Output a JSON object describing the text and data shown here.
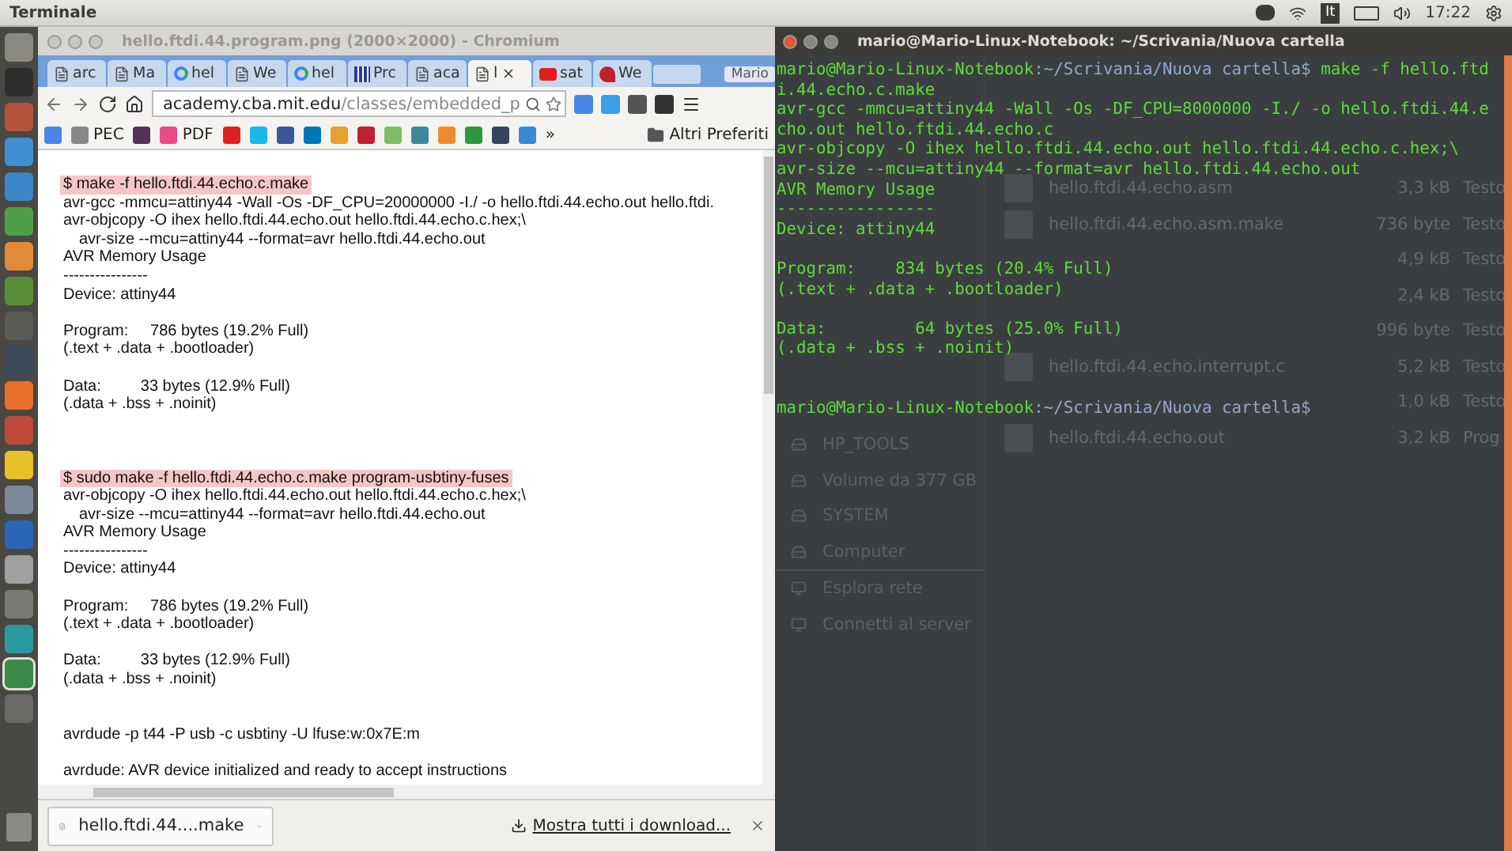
{
  "top_panel": {
    "title": "Terminale",
    "keyboard": "It",
    "clock": "17:22"
  },
  "launcher": [
    {
      "color": "#8a8a80",
      "selected": false
    },
    {
      "color": "#2e2e2e",
      "selected": false
    },
    {
      "color": "#b5533c",
      "selected": false
    },
    {
      "color": "#3f8fd2",
      "selected": false
    },
    {
      "color": "#3a86c8",
      "selected": false
    },
    {
      "color": "#4ea046",
      "selected": false
    },
    {
      "color": "#e08a3a",
      "selected": false
    },
    {
      "color": "#5a8f3a",
      "selected": false
    },
    {
      "color": "#5b5b55",
      "selected": false
    },
    {
      "color": "#3b4a5a",
      "selected": false
    },
    {
      "color": "#e8702a",
      "selected": false
    },
    {
      "color": "#c04a3a",
      "selected": false
    },
    {
      "color": "#e8c02a",
      "selected": false
    },
    {
      "color": "#7a8a9a",
      "selected": false
    },
    {
      "color": "#2a66b8",
      "selected": false
    },
    {
      "color": "#a0a0a0",
      "selected": false
    },
    {
      "color": "#7a7a72",
      "selected": false
    },
    {
      "color": "#2a9aa0",
      "selected": false
    },
    {
      "color": "#3a8a4a",
      "selected": true
    },
    {
      "color": "#6a6a66",
      "selected": false
    }
  ],
  "browser": {
    "title": "hello.ftdi.44.program.png (2000×2000) - Chromium",
    "tabs": [
      {
        "label": "arc",
        "kind": "page",
        "selected": false
      },
      {
        "label": "Ma",
        "kind": "page",
        "selected": false
      },
      {
        "label": "hel",
        "kind": "google",
        "selected": false
      },
      {
        "label": "We",
        "kind": "page",
        "selected": false
      },
      {
        "label": "hel",
        "kind": "google",
        "selected": false
      },
      {
        "label": "Prc",
        "kind": "grid",
        "selected": false
      },
      {
        "label": "aca",
        "kind": "page",
        "selected": false
      },
      {
        "label": "l",
        "kind": "page",
        "selected": true
      },
      {
        "label": "sat",
        "kind": "video",
        "selected": false
      },
      {
        "label": "We",
        "kind": "bird",
        "selected": false
      }
    ],
    "profile": "Mario",
    "url_host": "academy.cba.mit.edu",
    "url_path": "/classes/embedded_p",
    "extensions": [
      {
        "color": "#4a86e8"
      },
      {
        "color": "#3aa0e8"
      },
      {
        "color": "#555555"
      },
      {
        "color": "#333333"
      }
    ],
    "bookmarks": [
      {
        "color": "#4a86e8"
      },
      {
        "label": "PEC",
        "color": "#888888"
      },
      {
        "color": "#55305a"
      },
      {
        "label": "PDF",
        "color": "#e84a8a"
      },
      {
        "color": "#e02020"
      },
      {
        "color": "#1ab7ea"
      },
      {
        "color": "#3b5998"
      },
      {
        "color": "#0077b5"
      },
      {
        "color": "#e8a030"
      },
      {
        "color": "#c02030"
      },
      {
        "color": "#7ac060"
      },
      {
        "color": "#3a8a9a"
      },
      {
        "color": "#f08a30"
      },
      {
        "color": "#2a9a3a"
      },
      {
        "color": "#35465c"
      },
      {
        "color": "#3a8ad8"
      }
    ],
    "more_bookmarks": "»",
    "other_bookmarks": "Altri Preferiti",
    "page_lines": [
      {
        "kind": "command",
        "text": "$ make -f hello.ftdi.44.echo.c.make"
      },
      {
        "kind": "output",
        "text": "avr-gcc -mmcu=attiny44 -Wall -Os -DF_CPU=20000000 -I./ -o hello.ftdi.44.echo.out hello.ftdi."
      },
      {
        "kind": "output",
        "text": "avr-objcopy -O ihex hello.ftdi.44.echo.out hello.ftdi.44.echo.c.hex;\\"
      },
      {
        "kind": "indented",
        "text": "avr-size --mcu=attiny44 --format=avr hello.ftdi.44.echo.out"
      },
      {
        "kind": "output",
        "text": "AVR Memory Usage"
      },
      {
        "kind": "output",
        "text": "----------------"
      },
      {
        "kind": "output",
        "text": "Device: attiny44"
      },
      {
        "kind": "blank"
      },
      {
        "kind": "output",
        "text": "Program:     786 bytes (19.2% Full)"
      },
      {
        "kind": "output",
        "text": "(.text + .data + .bootloader)"
      },
      {
        "kind": "blank"
      },
      {
        "kind": "output",
        "text": "Data:         33 bytes (12.9% Full)"
      },
      {
        "kind": "output",
        "text": "(.data + .bss + .noinit)"
      },
      {
        "kind": "blank"
      },
      {
        "kind": "blank"
      },
      {
        "kind": "blank"
      },
      {
        "kind": "command",
        "text": "$ sudo make -f hello.ftdi.44.echo.c.make program-usbtiny-fuses"
      },
      {
        "kind": "output",
        "text": "avr-objcopy -O ihex hello.ftdi.44.echo.out hello.ftdi.44.echo.c.hex;\\"
      },
      {
        "kind": "indented",
        "text": "avr-size --mcu=attiny44 --format=avr hello.ftdi.44.echo.out"
      },
      {
        "kind": "output",
        "text": "AVR Memory Usage"
      },
      {
        "kind": "output",
        "text": "----------------"
      },
      {
        "kind": "output",
        "text": "Device: attiny44"
      },
      {
        "kind": "blank"
      },
      {
        "kind": "output",
        "text": "Program:     786 bytes (19.2% Full)"
      },
      {
        "kind": "output",
        "text": "(.text + .data + .bootloader)"
      },
      {
        "kind": "blank"
      },
      {
        "kind": "output",
        "text": "Data:         33 bytes (12.9% Full)"
      },
      {
        "kind": "output",
        "text": "(.data + .bss + .noinit)"
      },
      {
        "kind": "blank"
      },
      {
        "kind": "blank"
      },
      {
        "kind": "output",
        "text": "avrdude -p t44 -P usb -c usbtiny -U lfuse:w:0x7E:m"
      },
      {
        "kind": "blank"
      },
      {
        "kind": "output",
        "text": "avrdude: AVR device initialized and ready to accept instructions"
      }
    ],
    "download": {
      "file": "hello.ftdi.44....make",
      "show_all": "Mostra tutti i download..."
    }
  },
  "terminal": {
    "title": "mario@Mario-Linux-Notebook: ~/Scrivania/Nuova cartella",
    "lines": [
      {
        "kind": "prompt",
        "user": "mario@Mario-Linux-Notebook",
        "path": ":~/Scrivania/Nuova cartella$",
        "text": " make -f hello.ftd"
      },
      {
        "kind": "output",
        "text": "i.44.echo.c.make"
      },
      {
        "kind": "output",
        "text": "avr-gcc -mmcu=attiny44 -Wall -Os -DF_CPU=8000000 -I./ -o hello.ftdi.44.e"
      },
      {
        "kind": "output",
        "text": "cho.out hello.ftdi.44.echo.c"
      },
      {
        "kind": "output",
        "text": "avr-objcopy -O ihex hello.ftdi.44.echo.out hello.ftdi.44.echo.c.hex;\\"
      },
      {
        "kind": "output",
        "text": "avr-size --mcu=attiny44 --format=avr hello.ftdi.44.echo.out"
      },
      {
        "kind": "output",
        "text": "AVR Memory Usage"
      },
      {
        "kind": "output",
        "text": "----------------"
      },
      {
        "kind": "output",
        "text": "Device: attiny44"
      },
      {
        "kind": "blank"
      },
      {
        "kind": "output",
        "text": "Program:    834 bytes (20.4% Full)"
      },
      {
        "kind": "output",
        "text": "(.text + .data + .bootloader)"
      },
      {
        "kind": "blank"
      },
      {
        "kind": "output",
        "text": "Data:         64 bytes (25.0% Full)"
      },
      {
        "kind": "output",
        "text": "(.data + .bss + .noinit)"
      },
      {
        "kind": "blank"
      },
      {
        "kind": "blank"
      },
      {
        "kind": "prompt",
        "user": "mario@Mario-Linux-Notebook",
        "path": ":~/Scrivania/Nuova cartella$"
      }
    ]
  },
  "file_manager": {
    "sidebar_groups": [
      {
        "items": [
          "HP_TOOLS",
          "Volume da 377 GB",
          "SYSTEM",
          "Computer"
        ]
      },
      {
        "items": [
          "Esplora rete",
          "Connetti al server"
        ]
      }
    ],
    "files": [
      {
        "name": "hello.ftdi.44.echo.asm",
        "size": "3,3 kB",
        "type": "Testo"
      },
      {
        "name": "hello.ftdi.44.echo.asm.make",
        "size": "736 byte",
        "type": "Testo"
      },
      {
        "size": "4,9 kB",
        "type": "Testo"
      },
      {
        "size": "2,4 kB",
        "type": "Testo"
      },
      {
        "size": "996 byte",
        "type": "Testo"
      },
      {
        "name": "hello.ftdi.44.echo.interrupt.c",
        "size": "5,2 kB",
        "type": "Testo"
      },
      {
        "size": "1,0 kB",
        "type": "Testo"
      },
      {
        "name": "hello.ftdi.44.echo.out",
        "size": "3,2 kB",
        "type": "Prog"
      }
    ]
  }
}
